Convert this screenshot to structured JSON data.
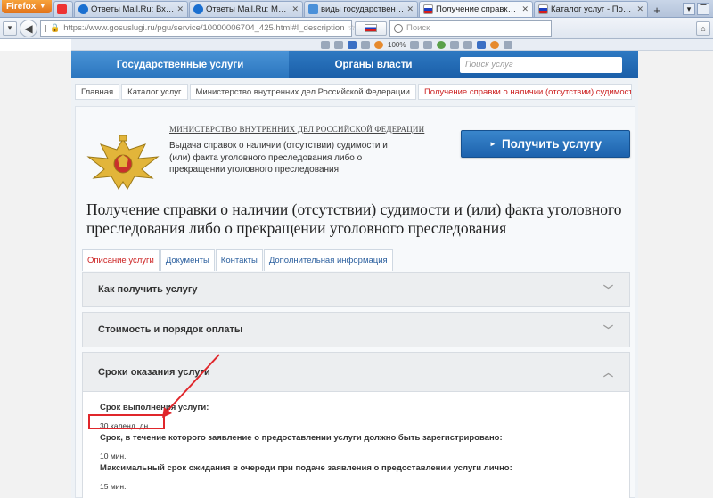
{
  "browser": {
    "app_button": "Firefox",
    "tabs": [
      {
        "label": "Ответы Mail.Ru: Входит ли ...",
        "active": false
      },
      {
        "label": "Ответы Mail.Ru: Можно ли ...",
        "active": false
      },
      {
        "label": "виды государственных усл...",
        "active": false
      },
      {
        "label": "Получение справки о нали...",
        "active": true
      },
      {
        "label": "Каталог услуг - Портал гос...",
        "active": false
      }
    ],
    "url": "https://www.gosuslugi.ru/pgu/service/10000006704_425.html#!_description",
    "search_placeholder": "Поиск",
    "zoom": "100%"
  },
  "site": {
    "nav": {
      "item1": "Государственные услуги",
      "item2": "Органы власти",
      "search_placeholder": "Поиск услуг"
    },
    "breadcrumb": [
      "Главная",
      "Каталог услуг",
      "Министерство внутренних дел Российской Федерации",
      "Получение справки о наличии (отсутствии) судимости и..."
    ],
    "ministry": "МИНИСТЕРСТВО ВНУТРЕННИХ ДЕЛ РОССИЙСКОЙ ФЕДЕРАЦИИ",
    "service_short": "Выдача справок о наличии (отсутствии) судимости и (или) факта уголовного преследования либо о прекращении уголовного преследования",
    "get_button": "Получить услугу",
    "title": "Получение справки о наличии (отсутствии) судимости и (или) факта уголовного преследования либо о прекращении уголовного преследования",
    "content_tabs": [
      "Описание услуги",
      "Документы",
      "Контакты",
      "Дополнительная информация"
    ],
    "accordion": [
      {
        "label": "Как получить услугу",
        "expanded": false
      },
      {
        "label": "Стоимость и порядок оплаты",
        "expanded": false
      },
      {
        "label": "Сроки оказания услуги",
        "expanded": true
      }
    ],
    "terms": {
      "execution_label": "Срок выполнения услуги:",
      "execution_value": "30 календ. дн.",
      "registration_label": "Срок, в течение которого заявление о предоставлении услуги должно быть зарегистрировано:",
      "registration_value": "10 мин.",
      "queue_label": "Максимальный срок ожидания в очереди при подаче заявления о предоставлении услуги лично:",
      "queue_value": "15 мин."
    }
  },
  "colors": {
    "nav_blue": "#1a5ea8",
    "annotation_red": "#e0262b",
    "active_tab_red": "#cc2222"
  }
}
